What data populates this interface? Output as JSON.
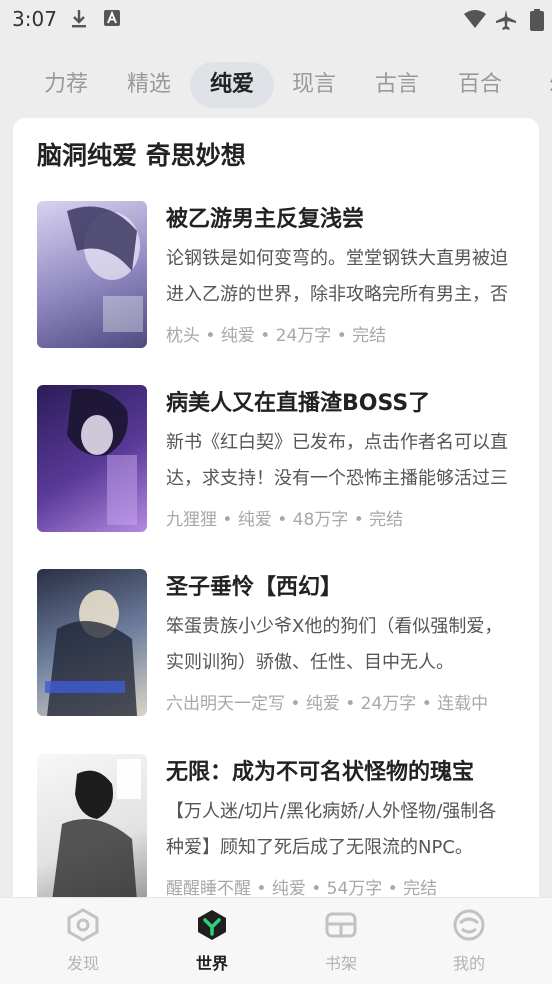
{
  "status_bar": {
    "time": "3:07"
  },
  "tabs": [
    {
      "label": "力荐"
    },
    {
      "label": "精选"
    },
    {
      "label": "纯爱"
    },
    {
      "label": "现言"
    },
    {
      "label": "古言"
    },
    {
      "label": "百合"
    },
    {
      "label": "幻"
    }
  ],
  "section": {
    "title": "脑洞纯爱 奇思妙想",
    "books": [
      {
        "title": "被乙游男主反复浅尝",
        "desc": "论钢铁是如何变弯的。堂堂钢铁大直男被迫进入乙游的世界，除非攻略完所有男主，否则无法回到现实。",
        "meta": "枕头 • 纯爱 • 24万字 • 完结",
        "cover_colors": [
          "#c9c2e8",
          "#6f6aa0"
        ]
      },
      {
        "title": "病美人又在直播渣BOSS了",
        "desc": "新书《红白契》已发布，点击作者名可以直达，求支持！没有一个恐怖主播能够活过三期。",
        "meta": "九狸狸 • 纯爱 • 48万字 • 完结",
        "cover_colors": [
          "#3a2a6e",
          "#9a63c9"
        ]
      },
      {
        "title": "圣子垂怜【西幻】",
        "desc": "笨蛋贵族小少爷X他的狗们（看似强制爱，实则训狗）骄傲、任性、目中无人。",
        "meta": "六出明天一定写 • 纯爱 • 24万字 • 连载中",
        "cover_colors": [
          "#1e2333",
          "#7a8fb0"
        ]
      },
      {
        "title": "无限：成为不可名状怪物的瑰宝",
        "desc": "【万人迷/切片/黑化病娇/人外怪物/强制各种爱】顾知了死后成了无限流的NPC。",
        "meta": "醒醒睡不醒 • 纯爱 • 54万字 • 完结",
        "cover_colors": [
          "#f0f0f0",
          "#3a3a3a"
        ]
      }
    ]
  },
  "bottom_nav": [
    {
      "label": "发现"
    },
    {
      "label": "世界"
    },
    {
      "label": "书架"
    },
    {
      "label": "我的"
    }
  ]
}
